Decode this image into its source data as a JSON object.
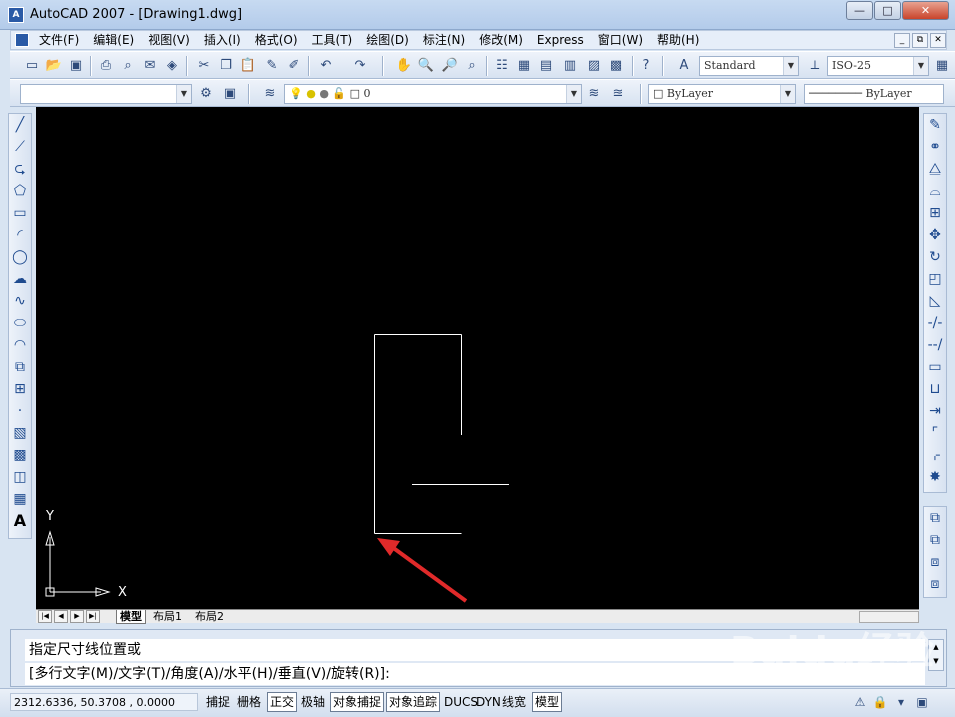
{
  "window": {
    "app_icon": "autocad-app-icon",
    "title": "AutoCAD 2007 - [Drawing1.dwg]",
    "minimize": "—",
    "maximize": "□",
    "close": "✕"
  },
  "menubar": {
    "items": [
      "文件(F)",
      "编辑(E)",
      "视图(V)",
      "插入(I)",
      "格式(O)",
      "工具(T)",
      "绘图(D)",
      "标注(N)",
      "修改(M)",
      "Express",
      "窗口(W)",
      "帮助(H)"
    ],
    "doc_minimize": "_",
    "doc_restore": "⧉",
    "doc_close": "✕"
  },
  "toolbar1": {
    "text_style": "Standard",
    "dim_style": "ISO-25"
  },
  "toolbar2": {
    "workspace": "",
    "layer": "0",
    "color": "ByLayer",
    "linetype": "ByLayer"
  },
  "layout": {
    "tabs": [
      "模型",
      "布局1",
      "布局2"
    ],
    "active_tab": "模型"
  },
  "ucs": {
    "x_label": "X",
    "y_label": "Y"
  },
  "command": {
    "line1": "指定尺寸线位置或",
    "line2": "[多行文字(M)/文字(T)/角度(A)/水平(H)/垂直(V)/旋转(R)]:"
  },
  "status": {
    "coordinates": "2312.6336, 50.3708 , 0.0000",
    "buttons": [
      "捕捉",
      "栅格",
      "正交",
      "极轴",
      "对象捕捉",
      "对象追踪",
      "DUCS",
      "DYN",
      "线宽",
      "模型"
    ],
    "on_buttons": [
      "正交",
      "对象捕捉",
      "对象追踪",
      "模型"
    ]
  },
  "watermark": {
    "text": "Baidu经验",
    "sub": "jingyan.baidu.com"
  },
  "colors": {
    "canvas_bg": "#000000",
    "geometry": "#ffffff",
    "arrow": "#e02a2a"
  }
}
